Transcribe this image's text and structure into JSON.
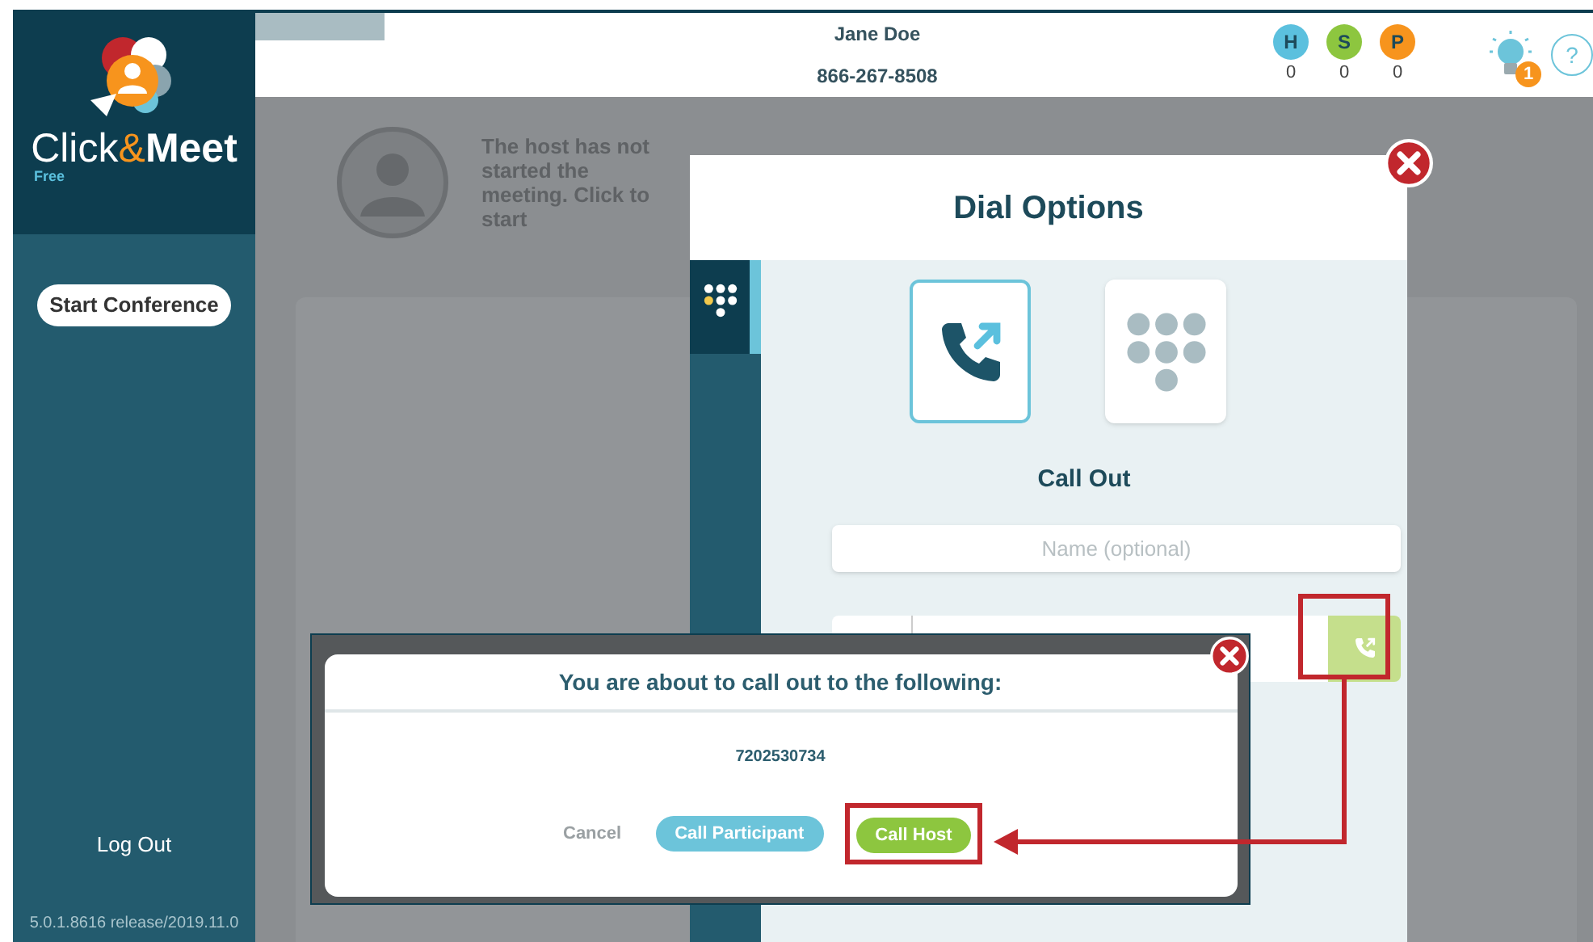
{
  "sidebar": {
    "brand": [
      {
        "text": "Click",
        "kind": "light"
      },
      {
        "text": "&",
        "kind": "accent"
      },
      {
        "text": "Meet",
        "kind": "bold"
      }
    ],
    "edition": "Free",
    "start_button": "Start Conference",
    "logout": "Log Out",
    "version": "5.0.1.8616 release/2019.11.0"
  },
  "header": {
    "user_name": "Jane Doe",
    "phone": "866-267-8508",
    "counters": [
      {
        "letter": "H",
        "count": "0",
        "color": "#5bc0de"
      },
      {
        "letter": "S",
        "count": "0",
        "color": "#8dc63f"
      },
      {
        "letter": "P",
        "count": "0",
        "color": "#f7941d"
      }
    ],
    "notification_count": "1",
    "help": "?"
  },
  "host_notice": "The host has not started the meeting. Click to start",
  "dial_options": {
    "title": "Dial Options",
    "modes": [
      {
        "kind": "call-out",
        "selected": true
      },
      {
        "kind": "keypad",
        "selected": false
      }
    ],
    "mode_label": "Call Out",
    "name_placeholder": "Name (optional)",
    "dial_button": {
      "highlighted": true
    }
  },
  "confirm": {
    "title": "You are about to call out to the following:",
    "number": "7202530734",
    "buttons": [
      {
        "label": "Cancel",
        "kind": "text",
        "highlighted": false
      },
      {
        "label": "Call Participant",
        "kind": "secondary",
        "highlighted": false
      },
      {
        "label": "Call Host",
        "kind": "primary",
        "highlighted": true
      }
    ]
  }
}
